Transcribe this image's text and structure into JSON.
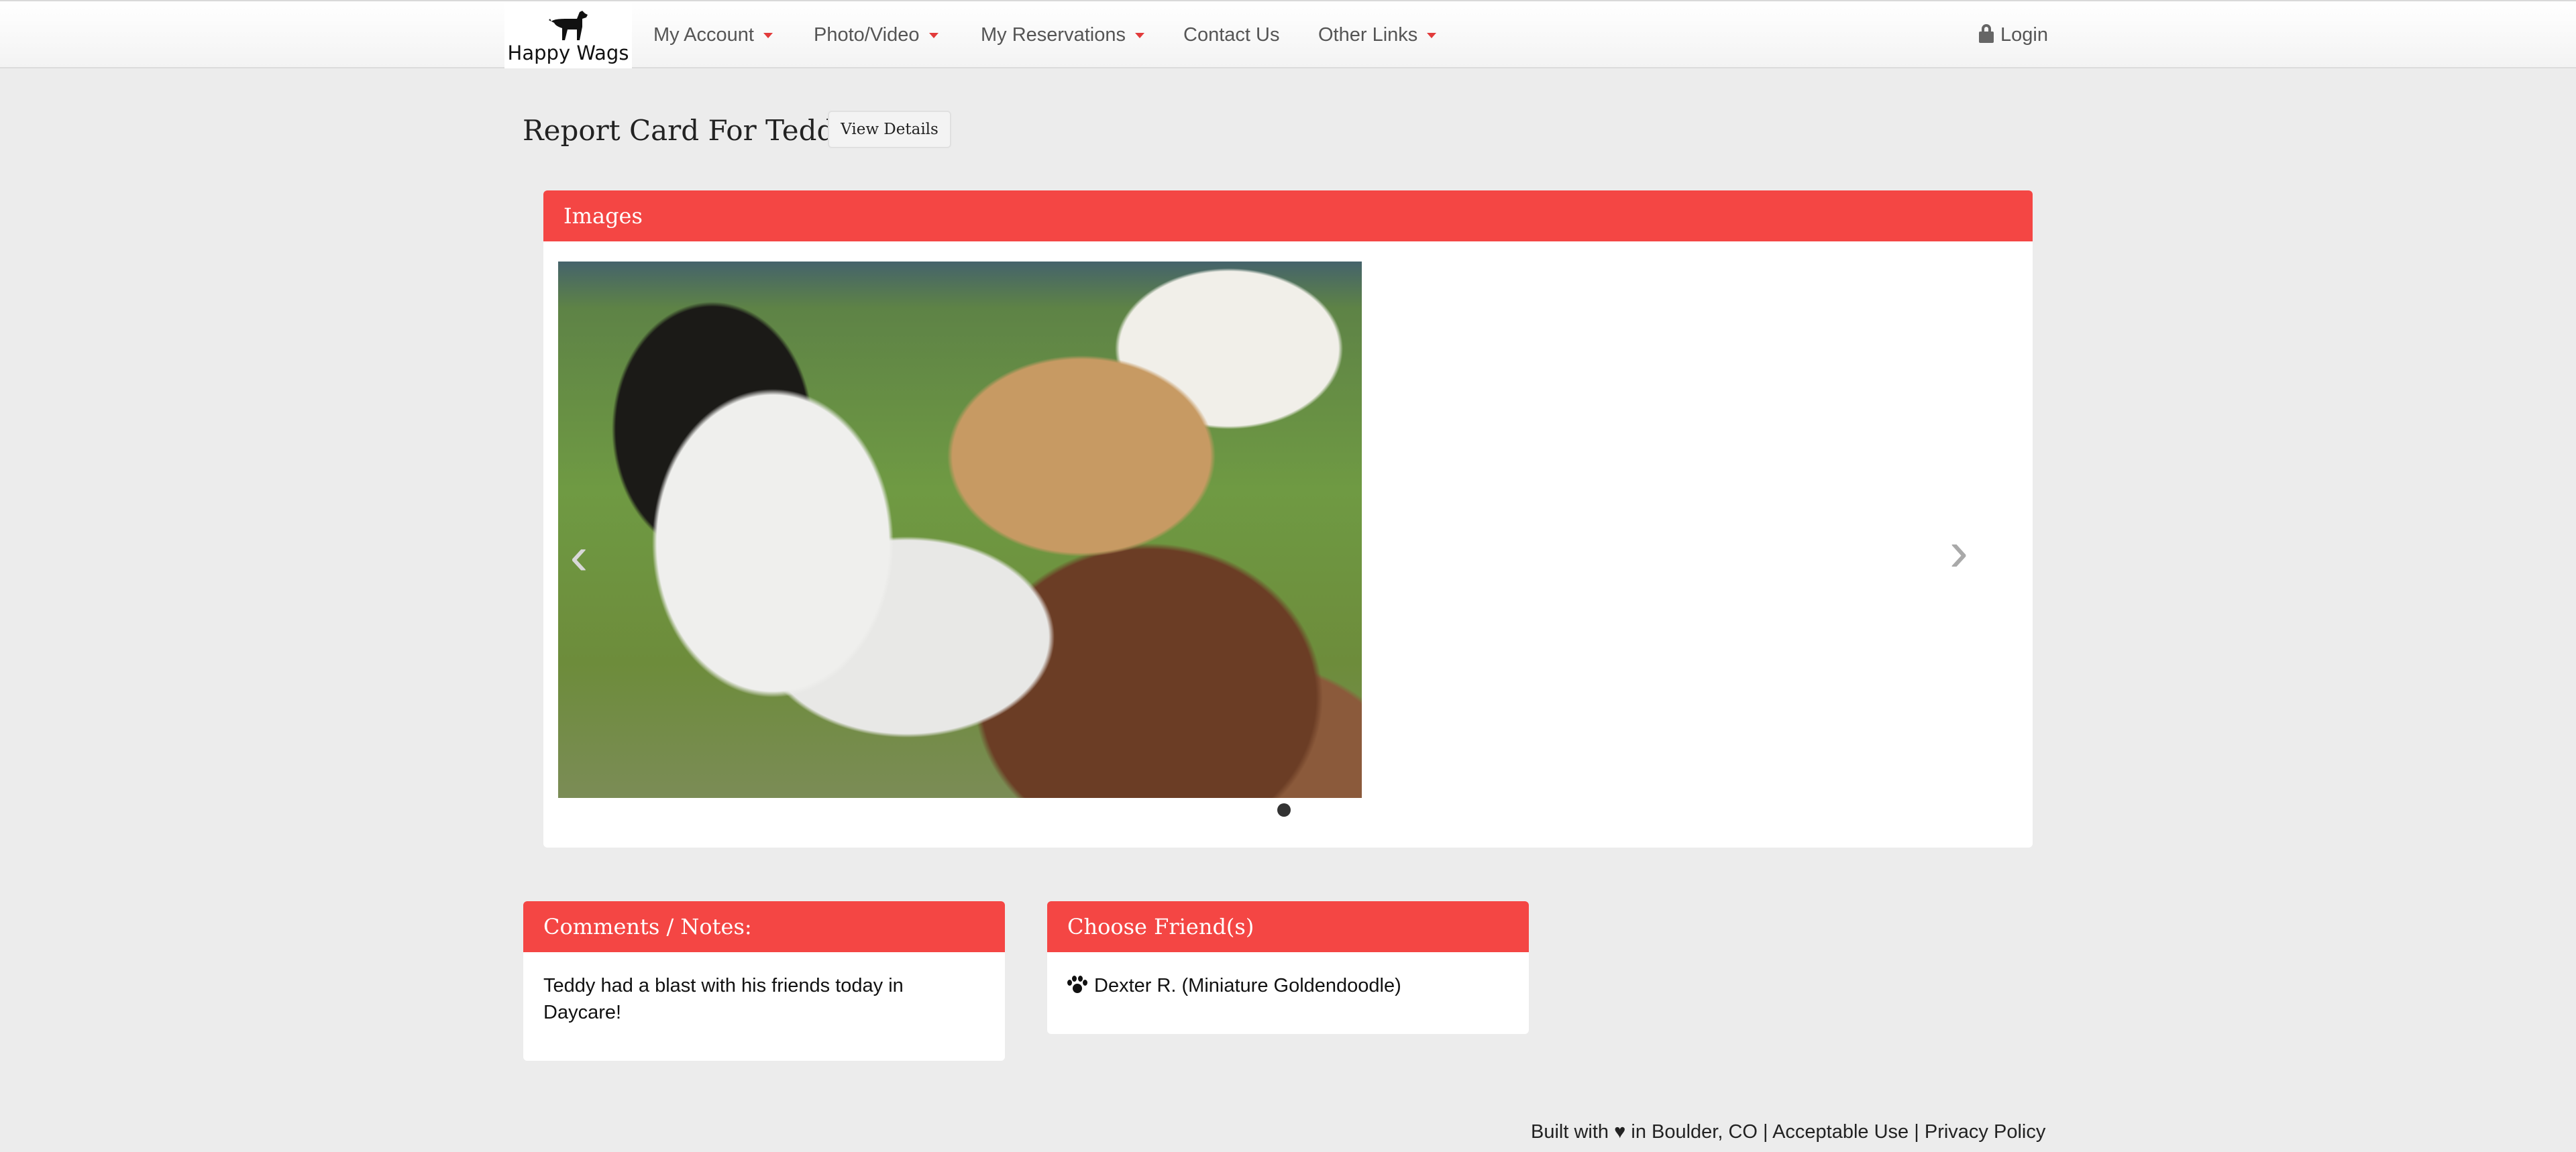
{
  "nav": {
    "brand": "Happy Wags",
    "items": [
      {
        "label": "My Account",
        "dropdown": true
      },
      {
        "label": "Photo/Video",
        "dropdown": true
      },
      {
        "label": "My Reservations",
        "dropdown": true
      },
      {
        "label": "Contact Us",
        "dropdown": false
      },
      {
        "label": "Other Links",
        "dropdown": true
      }
    ],
    "login": "Login"
  },
  "page": {
    "title": "Report Card For Teddy",
    "view_details": "View Details"
  },
  "images": {
    "heading": "Images",
    "slide_count": 1,
    "active_slide": 1
  },
  "comments": {
    "heading": "Comments / Notes:",
    "text": "Teddy had a blast with his friends today in Daycare!"
  },
  "friends": {
    "heading": "Choose Friend(s)",
    "items": [
      "Dexter R. (Miniature Goldendoodle)"
    ]
  },
  "footer": {
    "built": "Built with ♥ in Boulder, CO",
    "sep": "|",
    "acceptable_use": "Acceptable Use",
    "privacy": "Privacy Policy"
  },
  "colors": {
    "accent": "#f44644",
    "background": "#ececec"
  }
}
